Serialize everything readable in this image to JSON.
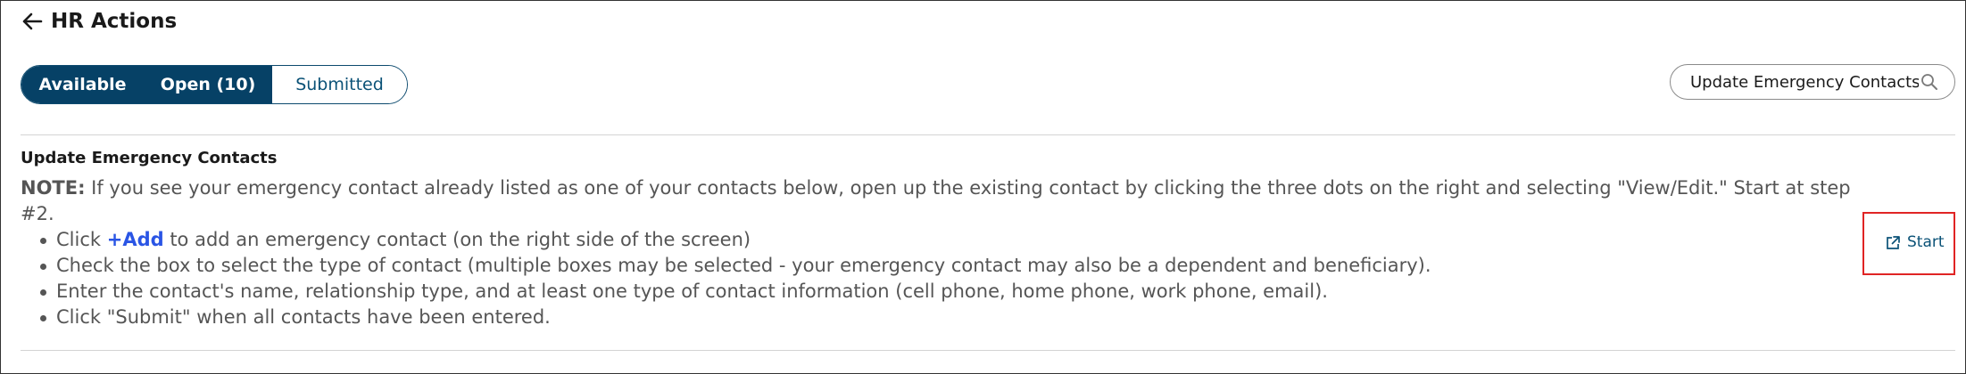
{
  "header": {
    "back_icon": "arrow-left-icon",
    "title": "HR Actions"
  },
  "tabs": [
    {
      "label": "Available",
      "state": "active"
    },
    {
      "label": "Open (10)",
      "state": "active"
    },
    {
      "label": "Submitted",
      "state": "inactive"
    }
  ],
  "search": {
    "value": "Update Emergency Contacts",
    "icon": "search-icon"
  },
  "item": {
    "title": "Update Emergency Contacts",
    "note_label": "NOTE:",
    "note_text": " If you see your emergency contact already listed as one of your contacts below, open up the existing contact by clicking the three dots on the right and selecting \"View/Edit.\" Start at step #2.",
    "step1_before": "Click ",
    "step1_link": "+Add",
    "step1_after": " to add an emergency contact (on the right side of the screen)",
    "step2": "Check the box to select the type of contact (multiple boxes may be selected - your emergency contact may also be a dependent and beneficiary).",
    "step3": "Enter the contact's name, relationship type, and at least one type of contact information (cell phone, home phone, work phone, email).",
    "step4": "Click \"Submit\" when all contacts have been entered."
  },
  "start": {
    "label": "Start",
    "icon": "external-link-icon"
  },
  "colors": {
    "tab_active_bg": "#064166",
    "link_blue": "#2a55e5",
    "highlight_red": "#e02424"
  }
}
